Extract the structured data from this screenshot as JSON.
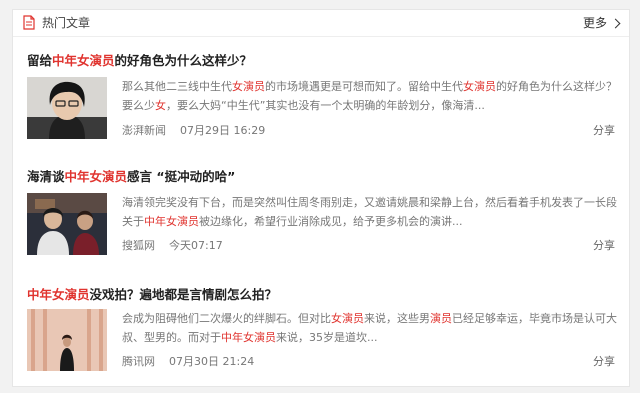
{
  "header": {
    "title": "热门文章",
    "more": "更多"
  },
  "articles": [
    {
      "title_pre": "留给",
      "title_hl": "中年女演员",
      "title_post": "的好角色为什么这样少？",
      "line1": [
        {
          "t": "那么其他二三线中生代"
        },
        {
          "t": "女演员",
          "hl": true
        },
        {
          "t": "的市场境遇更是可想而知了。留给中生代"
        },
        {
          "t": "女演员",
          "hl": true
        },
        {
          "t": "的好角色为什么这样少？"
        }
      ],
      "line2": [
        {
          "t": "要么少"
        },
        {
          "t": "女",
          "hl": true
        },
        {
          "t": "，要么大妈“中生代”其实也没有一个太明确的年龄划分，像海清..."
        }
      ],
      "source": "澎湃新闻",
      "time": "07月29日 16:29",
      "share": "分享"
    },
    {
      "title_pre": "海清谈",
      "title_hl": "中年女演员",
      "title_post": "感言 “挺冲动的哈”",
      "line1": [
        {
          "t": "海清领完奖没有下台，而是突然叫住周冬雨别走，又邀请姚晨和梁静上台，然后看着手机发表了一长段"
        }
      ],
      "line2": [
        {
          "t": "关于"
        },
        {
          "t": "中年女演员",
          "hl": true
        },
        {
          "t": "被边缘化，希望行业消除成见，给予更多机会的演讲..."
        }
      ],
      "source": "搜狐网",
      "time": "今天07:17",
      "share": "分享"
    },
    {
      "title_pre": "",
      "title_hl": "中年女演员",
      "title_post": "没戏拍？遍地都是言情剧怎么拍？",
      "line1": [
        {
          "t": "会成为阻碍他们二次爆火的绊脚石。但对比"
        },
        {
          "t": "女演员",
          "hl": true
        },
        {
          "t": "来说，这些男"
        },
        {
          "t": "演员",
          "hl": true
        },
        {
          "t": "已经足够幸运，毕竟市场是认可大"
        }
      ],
      "line2": [
        {
          "t": "叔、型男的。而对于"
        },
        {
          "t": "中年女演员",
          "hl": true
        },
        {
          "t": "来说，35岁是道坎..."
        }
      ],
      "source": "腾讯网",
      "time": "07月30日 21:24",
      "share": "分享"
    }
  ]
}
